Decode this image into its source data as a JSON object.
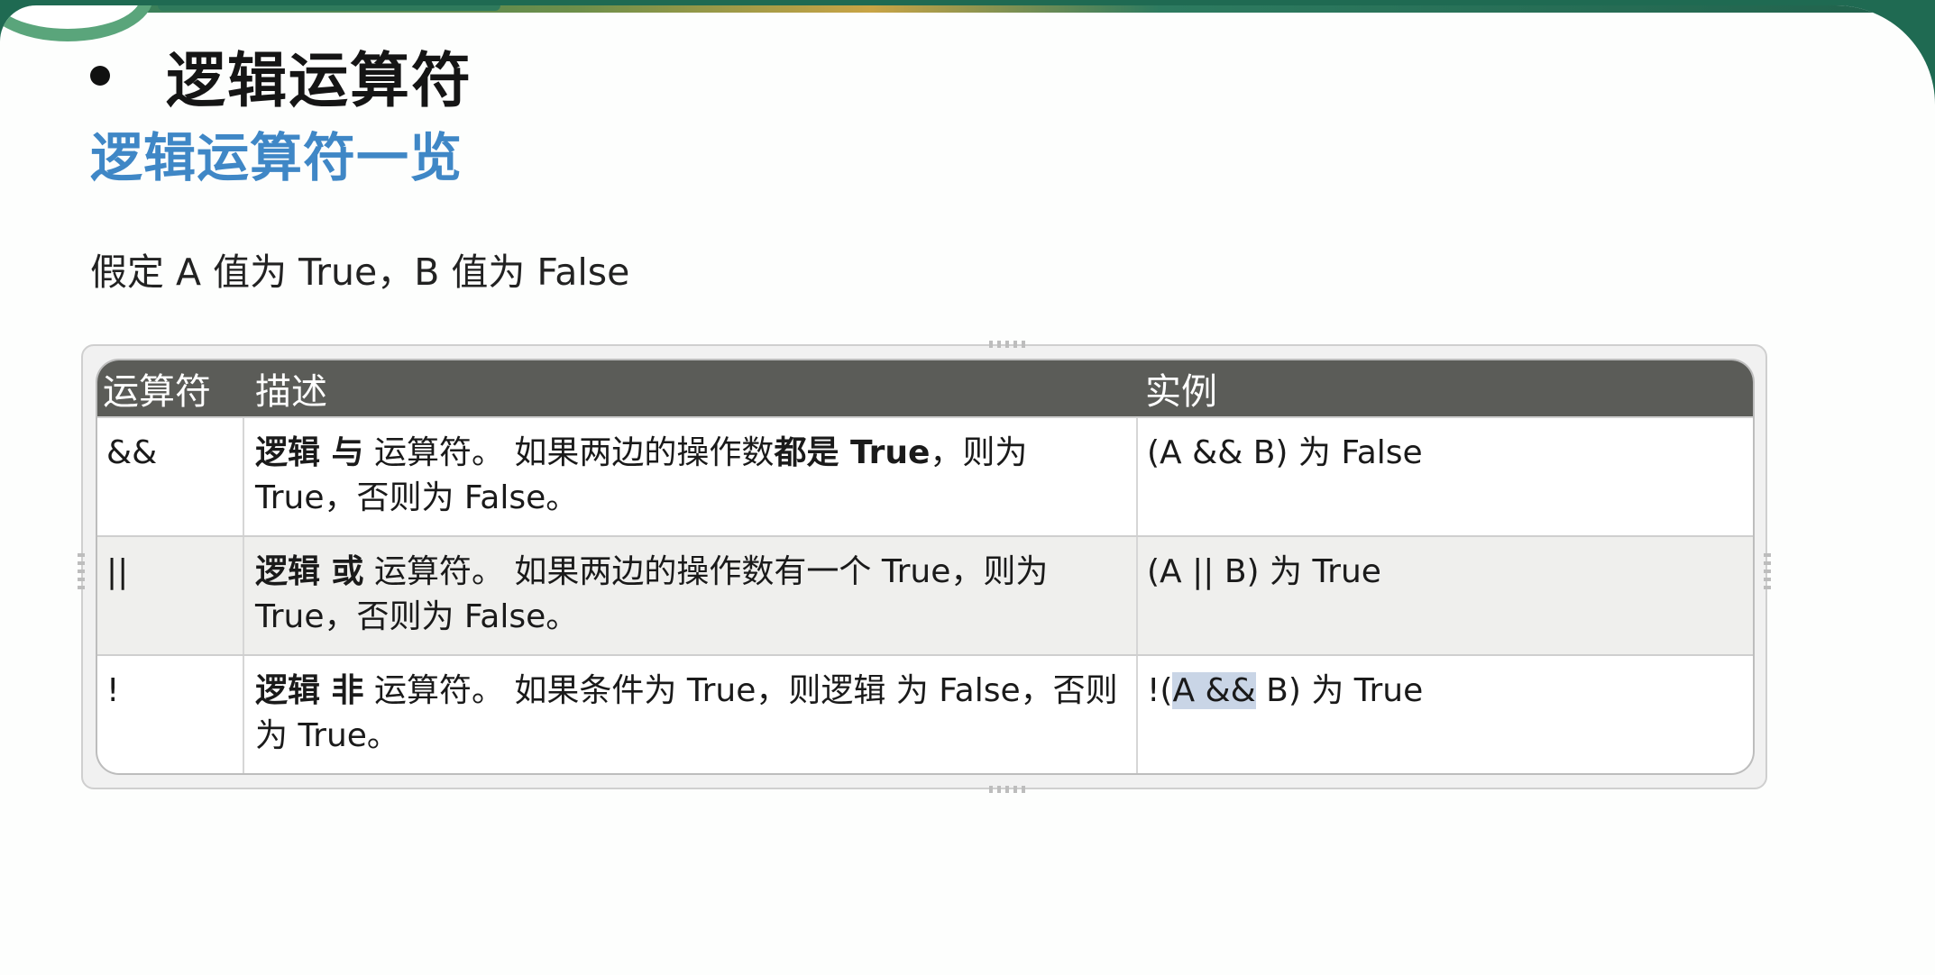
{
  "heading": "逻辑运算符",
  "subheading": "逻辑运算符一览",
  "assumption": "假定 A 值为 True，B 值为 False",
  "table": {
    "headers": [
      "运算符",
      "描述",
      "实例"
    ],
    "rows": [
      {
        "operator": "&&",
        "desc_bold_1": "逻辑 与",
        "desc_text_1": " 运算符。 如果两边的操作数",
        "desc_bold_2": "都是 True",
        "desc_text_2": "，则为 True，否则为 False。",
        "example": "(A && B) 为 False"
      },
      {
        "operator": "||",
        "desc_bold_1": "逻辑 或",
        "desc_text_1": " 运算符。 如果两边的操作数有一个 True，则为 True，否则为 False。",
        "example": "(A || B) 为 True"
      },
      {
        "operator": "!",
        "desc_bold_1": "逻辑 非",
        "desc_text_1": " 运算符。 如果条件为 True，则逻辑 为 False，否则为 True。",
        "example_prefix": "!(",
        "example_highlight": "A &&",
        "example_suffix": " B) 为 True"
      }
    ]
  }
}
